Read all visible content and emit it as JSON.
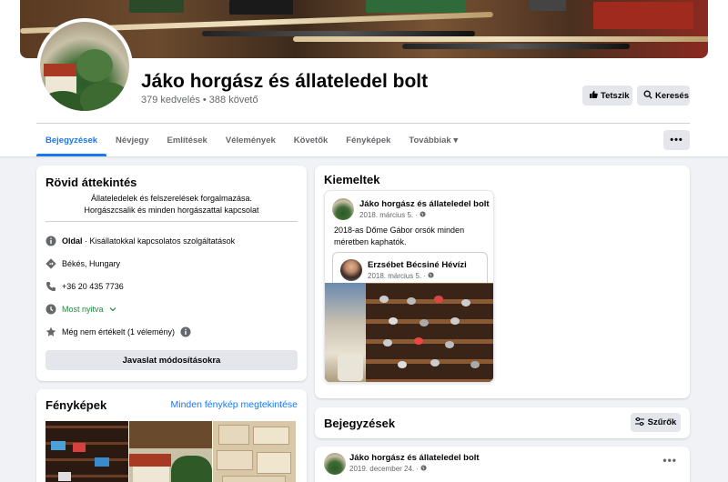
{
  "page": {
    "title": "Jáko horgász és állateledel bolt",
    "stats": "379 kedvelés • 388 követő",
    "like_label": "Tetszik",
    "search_label": "Keresés"
  },
  "tabs": [
    {
      "label": "Bejegyzések",
      "active": true
    },
    {
      "label": "Névjegy"
    },
    {
      "label": "Említések"
    },
    {
      "label": "Vélemények"
    },
    {
      "label": "Követők"
    },
    {
      "label": "Fényképek"
    },
    {
      "label": "Továbbiak ▾"
    }
  ],
  "more_button": "•••",
  "about": {
    "heading": "Rövid áttekintés",
    "intro_line1": "Állateledelek és felszerelések forgalmazása.",
    "intro_line2": "Horgászcsalik és minden horgászattal kapcsolat",
    "page_bold": "Oldal",
    "page_category": " · Kisállatokkal kapcsolatos szolgáltatások",
    "location": "Békés, Hungary",
    "phone": "+36 20 435 7736",
    "open_status": "Most nyitva",
    "rating": "Még nem értékelt (1 vélemény)",
    "suggest_button": "Javaslat módosításokra"
  },
  "photos": {
    "heading": "Fényképek",
    "see_all": "Minden fénykép megtekintése"
  },
  "featured": {
    "heading": "Kiemeltek",
    "author": "Jáko horgász és állateledel bolt",
    "date": "2018. március 5. · ",
    "text_line1": "2018-as Dőme Gábor orsók minden",
    "text_line2": "méretben kaphatók.",
    "shared_author": "Erzsébet Bécsiné Hévízi",
    "shared_date": "2018. március 5. · "
  },
  "posts": {
    "heading": "Bejegyzések",
    "filter_label": "Szűrők",
    "author": "Jáko horgász és állateledel bolt",
    "date": "2019. december 24. · ",
    "more": "•••"
  },
  "colors": {
    "accent": "#1877f2",
    "open_green": "#1e8a3c",
    "background": "#f0f2f5"
  }
}
